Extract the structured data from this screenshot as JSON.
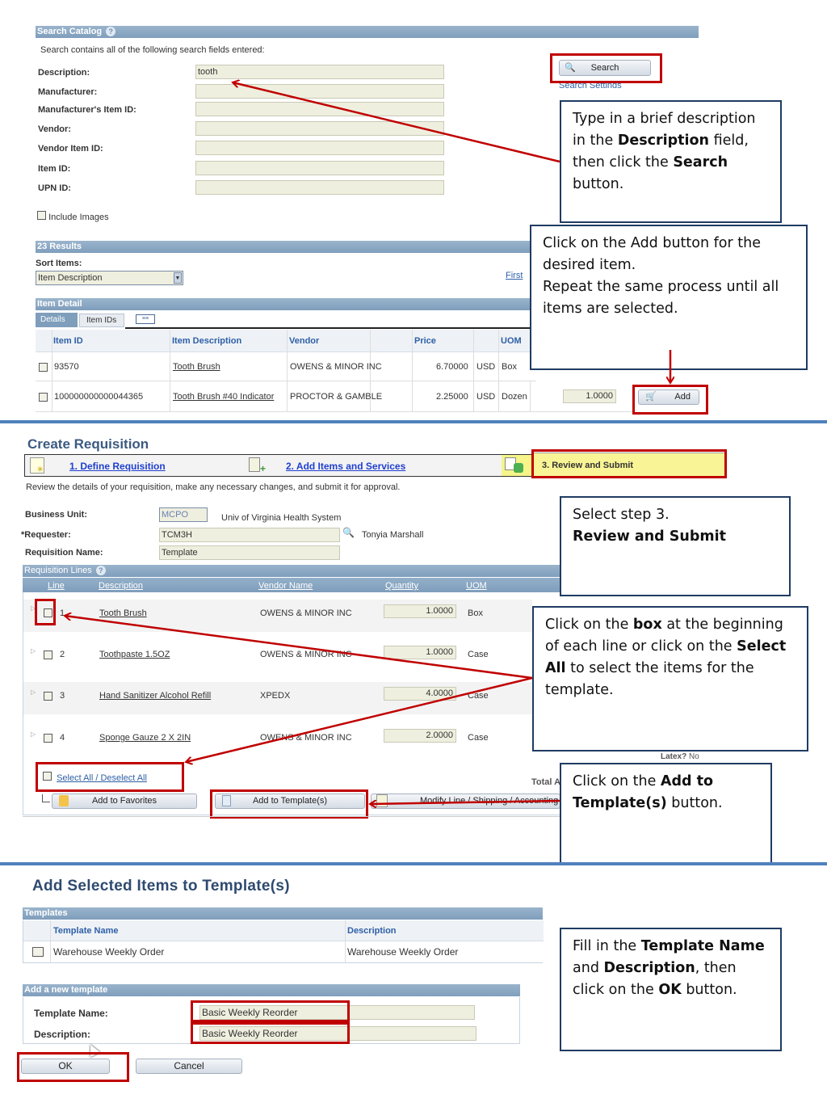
{
  "search_catalog": {
    "title": "Search Catalog",
    "subtitle": "Search contains all of the following search fields entered:",
    "fields": [
      {
        "label": "Description:",
        "value": "tooth"
      },
      {
        "label": "Manufacturer:",
        "value": ""
      },
      {
        "label": "Manufacturer's Item ID:",
        "value": ""
      },
      {
        "label": "Vendor:",
        "value": ""
      },
      {
        "label": "Vendor Item ID:",
        "value": ""
      },
      {
        "label": "Item ID:",
        "value": ""
      },
      {
        "label": "UPN ID:",
        "value": ""
      }
    ],
    "include_images_label": "Include Images",
    "search_button": "Search",
    "search_settings_link": "Search Settings"
  },
  "results": {
    "title": "23 Results",
    "sort_label": "Sort Items:",
    "sort_value": "Item Description",
    "first_link": "First",
    "item_detail_title": "Item Detail",
    "tabs": [
      "Details",
      "Item IDs"
    ],
    "columns": [
      "Item ID",
      "Item Description",
      "Vendor",
      "Price",
      "UOM"
    ],
    "rows": [
      {
        "item_id": "93570",
        "description": "Tooth Brush",
        "vendor": "OWENS & MINOR INC",
        "price": "6.70000",
        "currency": "USD",
        "uom": "Box",
        "qty": "",
        "add": "Add"
      },
      {
        "item_id": "100000000000044365",
        "description": "Tooth Brush #40 Indicator",
        "vendor": "PROCTOR & GAMBLE",
        "price": "2.25000",
        "currency": "USD",
        "uom": "Dozen",
        "qty": "1.0000",
        "add": "Add"
      }
    ]
  },
  "requisition": {
    "title": "Create Requisition",
    "steps": [
      "1. Define Requisition",
      "2. Add Items and Services",
      "3. Review and Submit"
    ],
    "instructions": "Review the details of your requisition, make any necessary changes, and submit it for approval.",
    "business_unit_label": "Business Unit:",
    "business_unit_value": "MCPO",
    "business_unit_desc": "Univ of Virginia Health System",
    "requester_label": "*Requester:",
    "requester_value": "TCM3H",
    "requester_name": "Tonyia Marshall",
    "req_name_label": "Requisition Name:",
    "req_name_value": "Template",
    "lines_title": "Requisition Lines",
    "columns": [
      "Line",
      "Description",
      "Vendor Name",
      "Quantity",
      "UOM"
    ],
    "lines": [
      {
        "line": "1",
        "description": "Tooth Brush",
        "vendor": "OWENS & MINOR INC",
        "qty": "1.0000",
        "uom": "Box"
      },
      {
        "line": "2",
        "description": "Toothpaste 1.5OZ",
        "vendor": "OWENS & MINOR INC",
        "qty": "1.0000",
        "uom": "Case"
      },
      {
        "line": "3",
        "description": "Hand Sanitizer Alcohol Refill",
        "vendor": "XPEDX",
        "qty": "4.0000",
        "uom": "Case"
      },
      {
        "line": "4",
        "description": "Sponge Gauze 2 X 2IN",
        "vendor": "OWENS & MINOR INC",
        "qty": "2.0000",
        "uom": "Case"
      }
    ],
    "latex_label": "Latex?",
    "latex_value": "No",
    "select_all": "Select All / Deselect All",
    "total_label": "Total A",
    "buttons": [
      "Add to Favorites",
      "Add to Template(s)",
      "Modify Line / Shipping / Accounting"
    ]
  },
  "template_page": {
    "title": "Add Selected Items to Template(s)",
    "templates_title": "Templates",
    "columns": [
      "Template Name",
      "Description"
    ],
    "rows": [
      {
        "name": "Warehouse Weekly Order",
        "description": "Warehouse Weekly Order"
      }
    ],
    "new_title": "Add a new template",
    "name_label": "Template Name:",
    "name_value": "Basic Weekly Reorder",
    "desc_label": "Description:",
    "desc_value": "Basic Weekly Reorder",
    "ok": "OK",
    "cancel": "Cancel"
  },
  "callouts": {
    "c1": [
      "Type in a brief description in the ",
      "Description",
      " field, then click the ",
      "Search",
      " button."
    ],
    "c2": [
      "Click on the Add button for the desired item.",
      "Repeat the same process until all items are selected."
    ],
    "c3": [
      "Select step 3.",
      "Review and Submit"
    ],
    "c4": [
      "Click on the ",
      "box",
      " at the beginning of each line or click on the ",
      "Select All",
      " to select the items for the template."
    ],
    "c5": [
      "Click on the ",
      "Add to Template(s)",
      " button."
    ],
    "c6": [
      "Fill in the ",
      "Template Name",
      " and ",
      "Description",
      ", then click on the ",
      "OK",
      " button."
    ]
  }
}
